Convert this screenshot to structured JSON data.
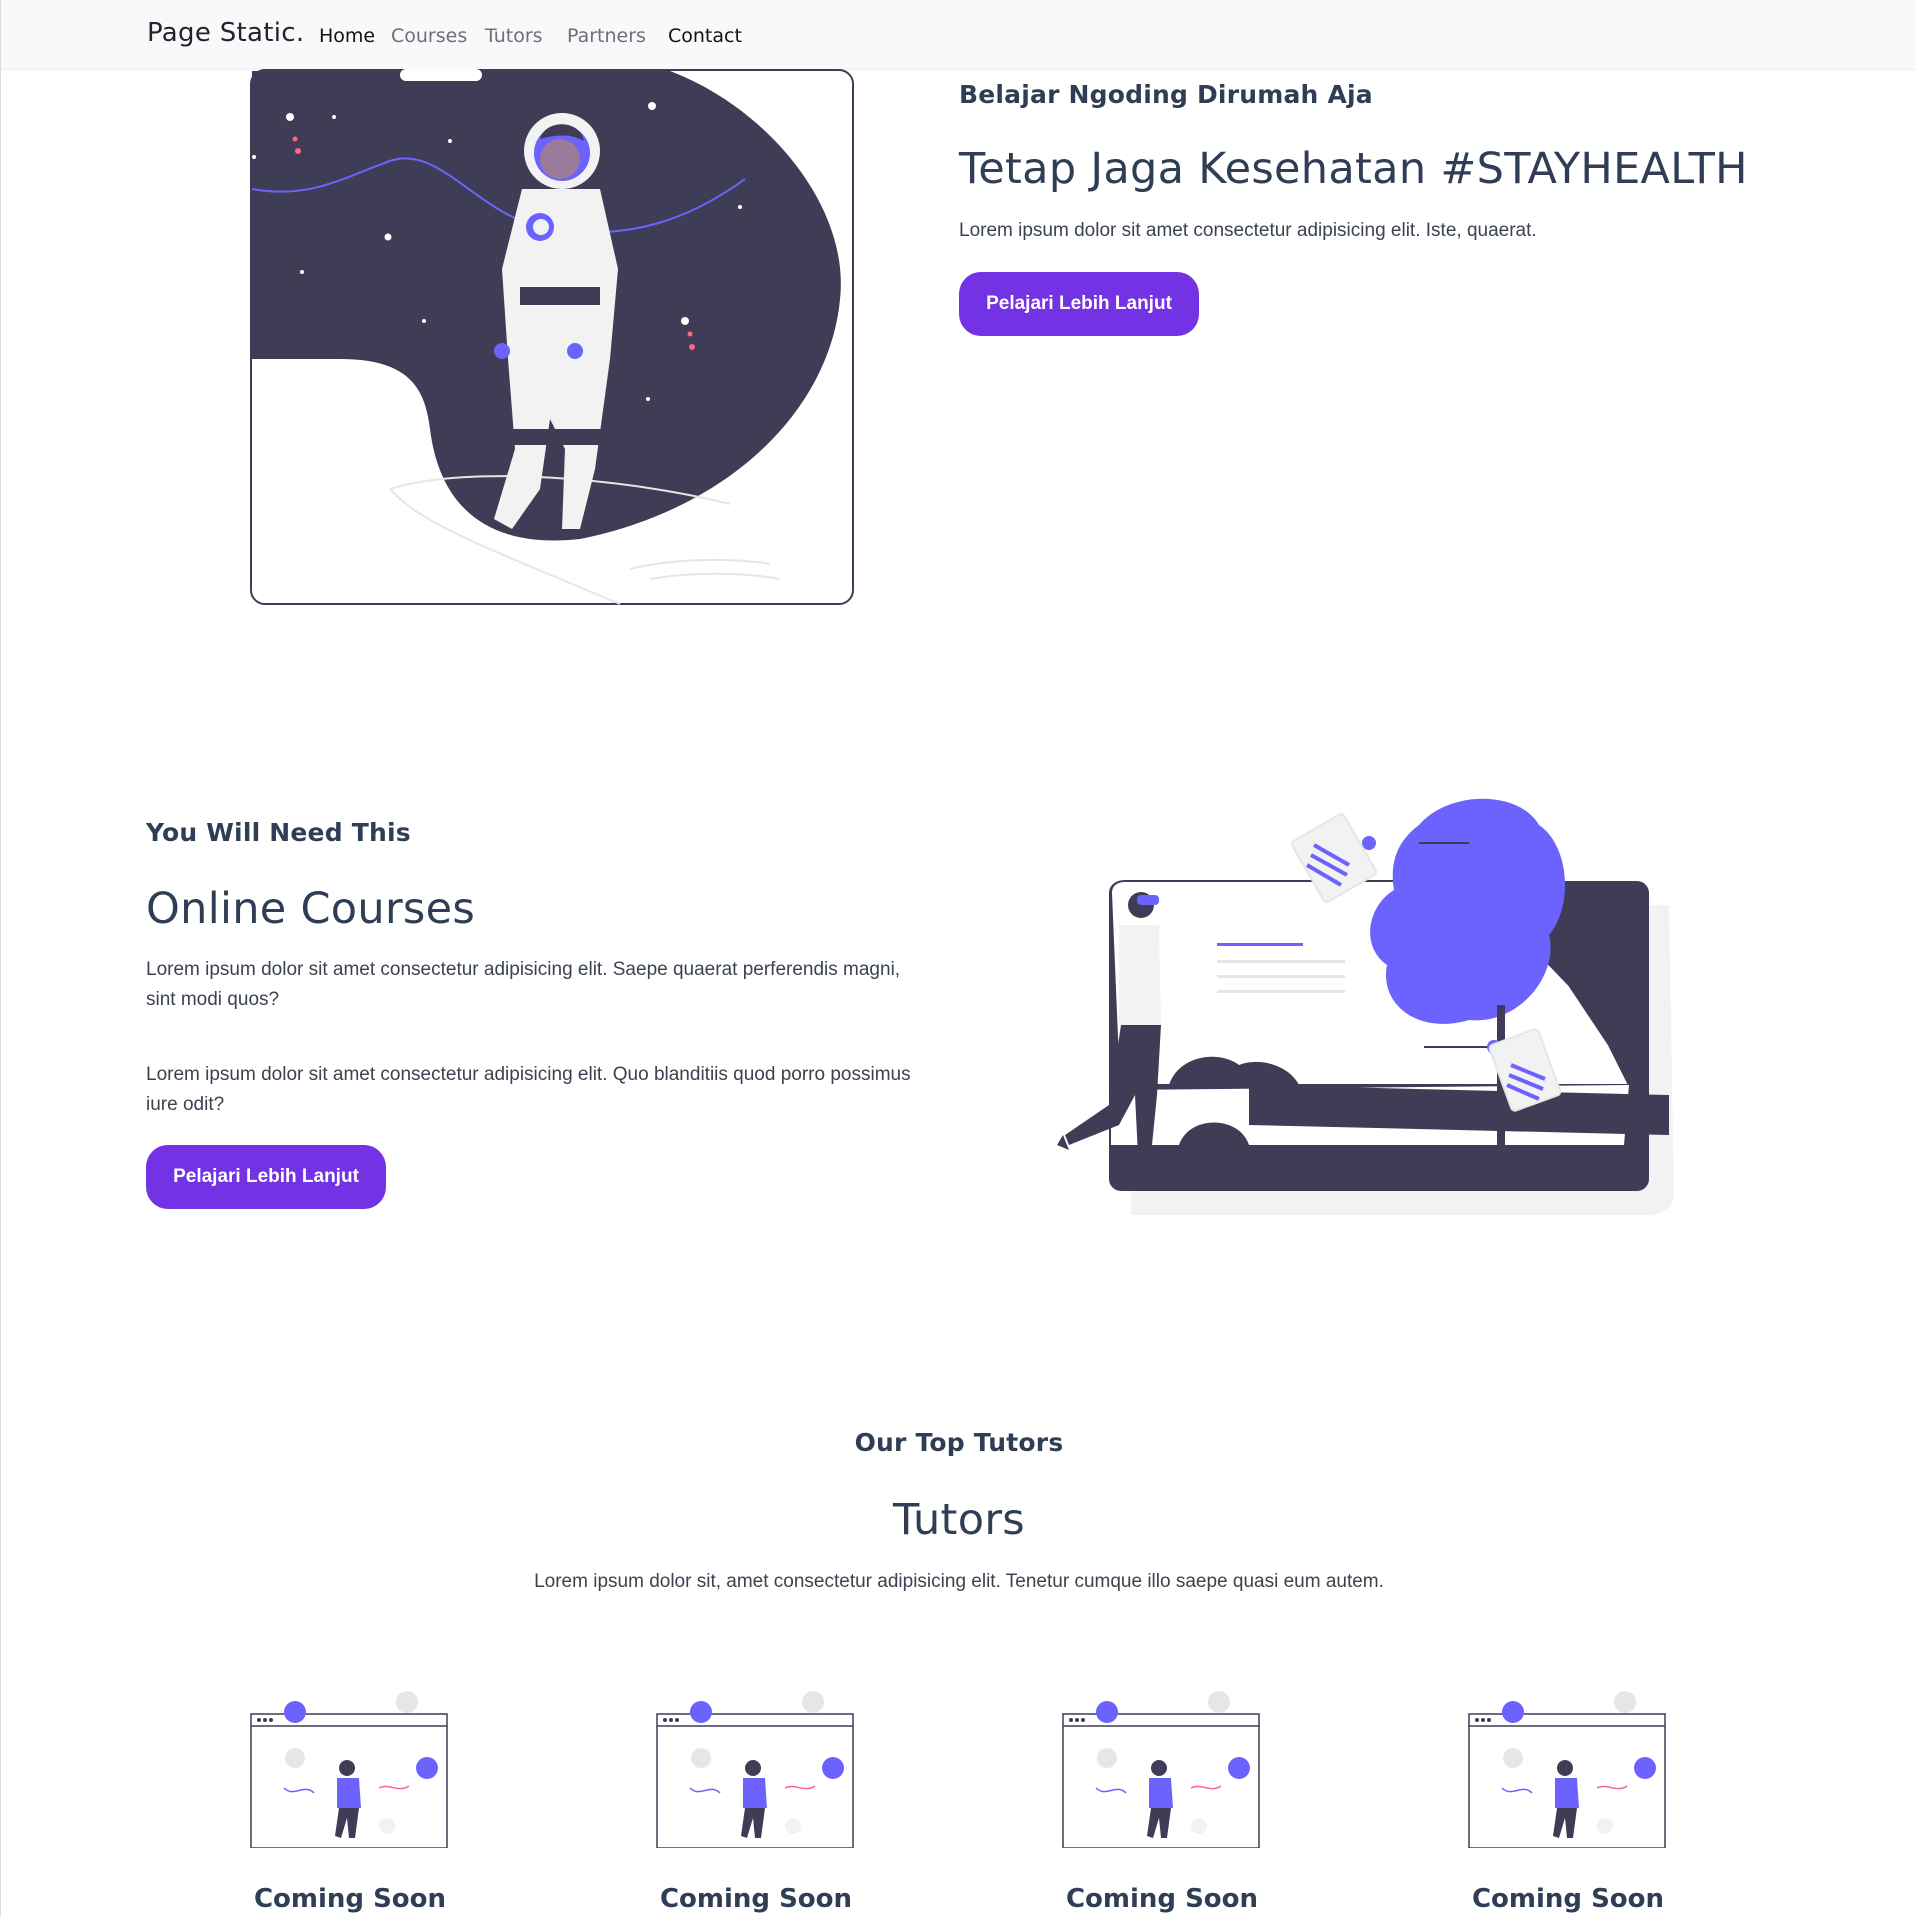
{
  "nav": {
    "brand": "Page Static.",
    "items": [
      {
        "label": "Home",
        "active": true
      },
      {
        "label": "Courses",
        "active": false
      },
      {
        "label": "Tutors",
        "active": false
      },
      {
        "label": "Partners",
        "active": false
      },
      {
        "label": "Contact",
        "active": true
      }
    ]
  },
  "hero": {
    "eyebrow": "Belajar Ngoding Dirumah Aja",
    "title": "Tetap Jaga Kesehatan #STAYHEALTH",
    "text": "Lorem ipsum dolor sit amet consectetur adipisicing elit. Iste, quaerat.",
    "button": "Pelajari Lebih Lanjut"
  },
  "courses": {
    "eyebrow": "You Will Need This",
    "title": "Online Courses",
    "paragraph_1_line_1": "Lorem ipsum dolor sit amet consectetur adipisicing elit. Saepe quaerat perferendis magni,",
    "paragraph_1_line_2": "sint modi quos?",
    "paragraph_2_line_1": "Lorem ipsum dolor sit amet consectetur adipisicing elit. Quo blanditiis quod porro possimus",
    "paragraph_2_line_2": "iure odit?",
    "button": "Pelajari Lebih Lanjut"
  },
  "tutors": {
    "eyebrow": "Our Top Tutors",
    "title": "Tutors",
    "text": "Lorem ipsum dolor sit, amet consectetur adipisicing elit. Tenetur cumque illo saepe quasi eum autem.",
    "cards": [
      {
        "name": "Coming Soon"
      },
      {
        "name": "Coming Soon"
      },
      {
        "name": "Coming Soon"
      },
      {
        "name": "Coming Soon"
      }
    ]
  },
  "colors": {
    "accent": "#7332e4",
    "illustration_purple": "#6c63ff",
    "illustration_dark": "#3f3d56",
    "heading": "#2f3e55",
    "navbar_bg": "#f8f9fa"
  },
  "icons": [
    "astronaut-illustration",
    "online-courses-illustration",
    "celebration-illustration"
  ]
}
